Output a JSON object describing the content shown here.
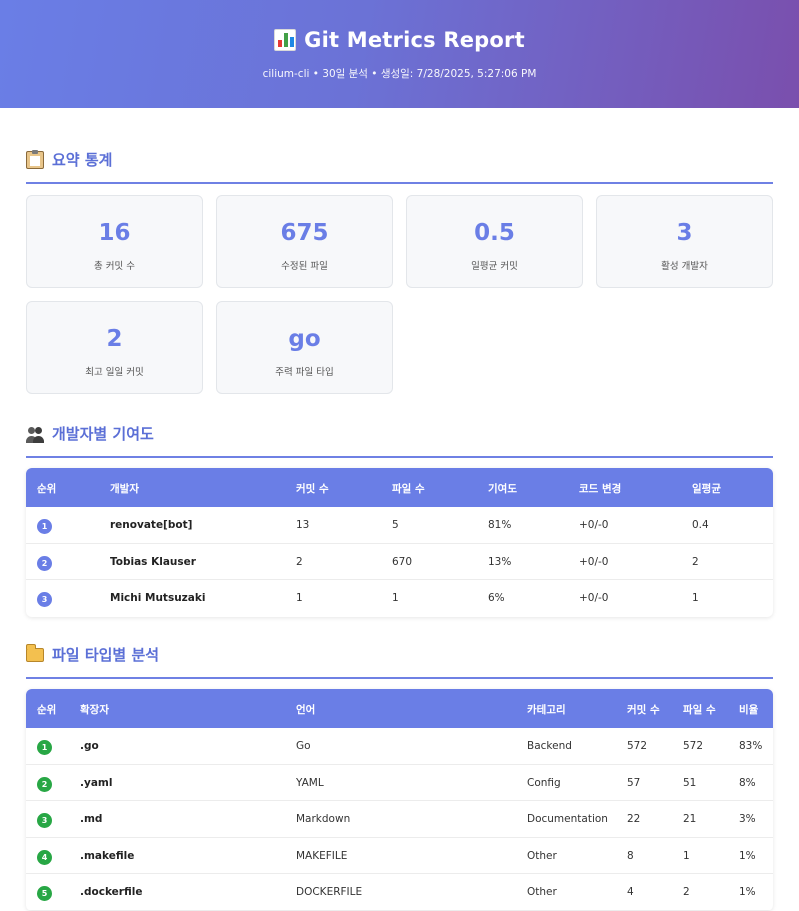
{
  "header": {
    "title": "Git Metrics Report",
    "subtitle": "cilium-cli • 30일 분석 • 생성일: 7/28/2025, 5:27:06 PM",
    "icon": "bar-chart-icon"
  },
  "summary": {
    "heading": "요약 통계",
    "icon": "clipboard-icon",
    "stats": [
      {
        "value": "16",
        "label": "총 커밋 수"
      },
      {
        "value": "675",
        "label": "수정된 파일"
      },
      {
        "value": "0.5",
        "label": "일평균 커밋"
      },
      {
        "value": "3",
        "label": "활성 개발자"
      },
      {
        "value": "2",
        "label": "최고 일일 커밋"
      },
      {
        "value": "go",
        "label": "주력 파일 타입"
      }
    ]
  },
  "developers": {
    "heading": "개발자별 기여도",
    "icon": "people-icon",
    "columns": [
      "순위",
      "개발자",
      "커밋 수",
      "파일 수",
      "기여도",
      "코드 변경",
      "일평균"
    ],
    "rows": [
      {
        "rank": "1",
        "name": "renovate[bot]",
        "commits": "13",
        "files": "5",
        "share": "81%",
        "changes": "+0/-0",
        "daily": "0.4"
      },
      {
        "rank": "2",
        "name": "Tobias Klauser",
        "commits": "2",
        "files": "670",
        "share": "13%",
        "changes": "+0/-0",
        "daily": "2"
      },
      {
        "rank": "3",
        "name": "Michi Mutsuzaki",
        "commits": "1",
        "files": "1",
        "share": "6%",
        "changes": "+0/-0",
        "daily": "1"
      }
    ]
  },
  "filetypes": {
    "heading": "파일 타입별 분석",
    "icon": "folder-icon",
    "columns": [
      "순위",
      "확장자",
      "언어",
      "카테고리",
      "커밋 수",
      "파일 수",
      "비율"
    ],
    "rows": [
      {
        "rank": "1",
        "ext": ".go",
        "lang": "Go",
        "category": "Backend",
        "commits": "572",
        "files": "572",
        "ratio": "83%"
      },
      {
        "rank": "2",
        "ext": ".yaml",
        "lang": "YAML",
        "category": "Config",
        "commits": "57",
        "files": "51",
        "ratio": "8%"
      },
      {
        "rank": "3",
        "ext": ".md",
        "lang": "Markdown",
        "category": "Documentation",
        "commits": "22",
        "files": "21",
        "ratio": "3%"
      },
      {
        "rank": "4",
        "ext": ".makefile",
        "lang": "MAKEFILE",
        "category": "Other",
        "commits": "8",
        "files": "1",
        "ratio": "1%"
      },
      {
        "rank": "5",
        "ext": ".dockerfile",
        "lang": "DOCKERFILE",
        "category": "Other",
        "commits": "4",
        "files": "2",
        "ratio": "1%"
      }
    ]
  },
  "colors": {
    "accent": "#6a7ee6",
    "gradient_end": "#7a4fad",
    "rank_dev": "#6a7ee6",
    "rank_file": "#28a745"
  }
}
